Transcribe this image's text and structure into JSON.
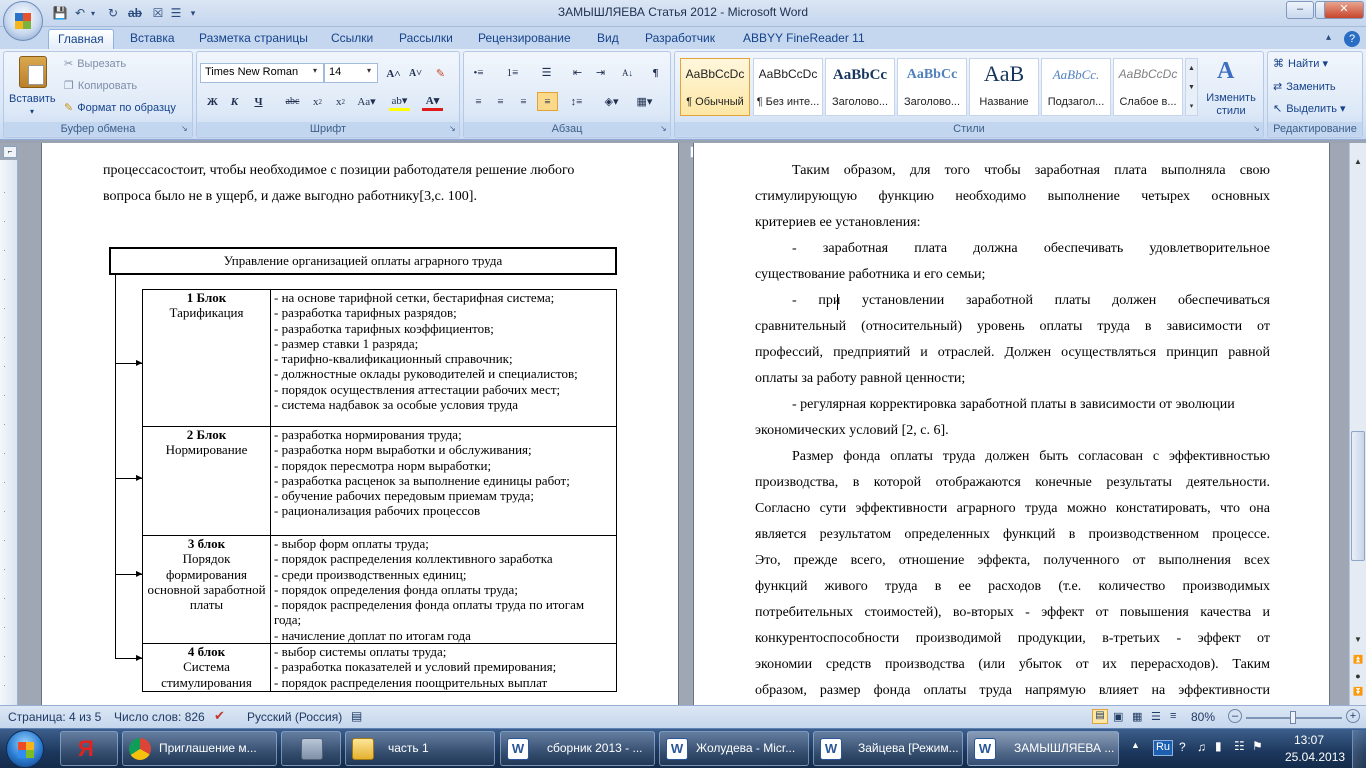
{
  "window": {
    "title": "ЗАМЫШЛЯЕВА  Статья 2012 - Microsoft Word"
  },
  "ribbon_tabs": [
    "Главная",
    "Вставка",
    "Разметка страницы",
    "Ссылки",
    "Рассылки",
    "Рецензирование",
    "Вид",
    "Разработчик",
    "ABBYY FineReader 11"
  ],
  "clipboard": {
    "paste": "Вставить",
    "cut": "Вырезать",
    "copy": "Копировать",
    "format_painter": "Формат по образцу",
    "group": "Буфер обмена"
  },
  "font": {
    "name": "Times New Roman",
    "size": "14",
    "group": "Шрифт"
  },
  "paragraph": {
    "group": "Абзац"
  },
  "styles": {
    "group": "Стили",
    "change": "Изменить стили",
    "items": [
      {
        "preview": "AaBbCcDc",
        "name": "¶ Обычный"
      },
      {
        "preview": "AaBbCcDc",
        "name": "¶ Без инте..."
      },
      {
        "preview": "AaBbCc",
        "name": "Заголово..."
      },
      {
        "preview": "AaBbCc",
        "name": "Заголово..."
      },
      {
        "preview": "AaB",
        "name": "Название"
      },
      {
        "preview": "AaBbCc.",
        "name": "Подзагол..."
      },
      {
        "preview": "AaBbCcDc",
        "name": "Слабое в..."
      }
    ]
  },
  "editing": {
    "group": "Редактирование",
    "find": "Найти",
    "replace": "Заменить",
    "select": "Выделить"
  },
  "left_page": {
    "intro": [
      "процессасостоит, чтобы необходимое с позиции работодателя решение любого",
      "вопроса было не в ущерб, и даже  выгодно работнику[3,с. 100]."
    ],
    "diagram_title": "Управление организацией оплаты аграрного труда",
    "blocks": [
      {
        "title": "1 Блок",
        "name": "Тарификация",
        "items": [
          "- на основе тарифной сетки, бестарифная система;",
          "- разработка тарифных разрядов;",
          "- разработка тарифных коэффициентов;",
          "- размер ставки 1 разряда;",
          "- тарифно-квалификационный справочник;",
          "- должностные оклады руководителей и специалистов;",
          "- порядок осуществления аттестации рабочих мест;",
          "- система надбавок за особые условия труда"
        ]
      },
      {
        "title": "2 Блок",
        "name": "Нормирование",
        "items": [
          "- разработка нормирования труда;",
          "- разработка норм выработки и обслуживания;",
          "- порядок пересмотра норм выработки;",
          "- разработка расценок за выполнение единицы работ;",
          "- обучение рабочих передовым приемам труда;",
          "- рационализация рабочих процессов"
        ]
      },
      {
        "title": "3 блок",
        "name": "Порядок формирования основной заработной платы",
        "items": [
          "- выбор форм оплаты труда;",
          "- порядок распределения коллективного заработка",
          "- среди производственных единиц;",
          "- порядок определения фонда оплаты труда;",
          "- порядок распределения фонда оплаты труда по итогам года;",
          "- начисление доплат по итогам года"
        ]
      },
      {
        "title": "4 блок",
        "name": "Система стимулирования",
        "items": [
          "- выбор системы оплаты труда;",
          "- разработка показателей и условий премирования;",
          "-   порядок распределения поощрительных выплат"
        ]
      }
    ]
  },
  "right_page": {
    "lines": [
      "Таким образом, для того чтобы заработная плата выполняла свою",
      "стимулирующую функцию необходимо выполнение  четырех основных",
      "критериев ее установления:",
      "- заработная плата должна обеспечивать удовлетворительное",
      "существование работника и его семьи;",
      "- при установлении заработной платы должен обеспечиваться",
      "сравнительный (относительный) уровень оплаты труда в зависимости от",
      "профессий, предприятий и отраслей. Должен осуществляться принцип равной",
      "оплаты за работу равной ценности;",
      "- регулярная корректировка заработной платы в зависимости от эволюции",
      "экономических условий [2, с. 6].",
      "Размер фонда оплаты труда должен быть согласован с эффективностью",
      "производства, в которой отображаются конечные результаты деятельности.",
      "Согласно сути эффективности аграрного труда можно констатировать, что она",
      "является результатом определенных функций в производственном процессе.",
      "Это, прежде всего, отношение эффекта, полученного от выполнения всех",
      "функций живого труда в ее расходов (т.е. количество производимых",
      "потребительных стоимостей), во-вторых - эффект от повышения качества и",
      "конкурентоспособности производимой продукции, в-третьих - эффект от",
      "экономии средств производства (или убыток от их перерасходов). Таким",
      "образом, размер фонда оплаты труда напрямую влияет на эффективности"
    ]
  },
  "ruler_numbers": [
    "2",
    "1",
    "1",
    "2",
    "3",
    "4",
    "5",
    "6",
    "7",
    "8",
    "9",
    "10",
    "11",
    "12",
    "13",
    "14",
    "15",
    "16",
    "18"
  ],
  "status": {
    "page": "Страница: 4 из 5",
    "words": "Число слов: 826",
    "language": "Русский (Россия)",
    "zoom": "80%"
  },
  "taskbar": {
    "items": [
      "Я",
      "Приглашение м...",
      "",
      "часть 1",
      "сборник 2013 - ...",
      "Жолудева - Micr...",
      "Зайцева [Режим...",
      "ЗАМЫШЛЯЕВА ..."
    ],
    "lang": "Ru",
    "time": "13:07",
    "date": "25.04.2013"
  }
}
